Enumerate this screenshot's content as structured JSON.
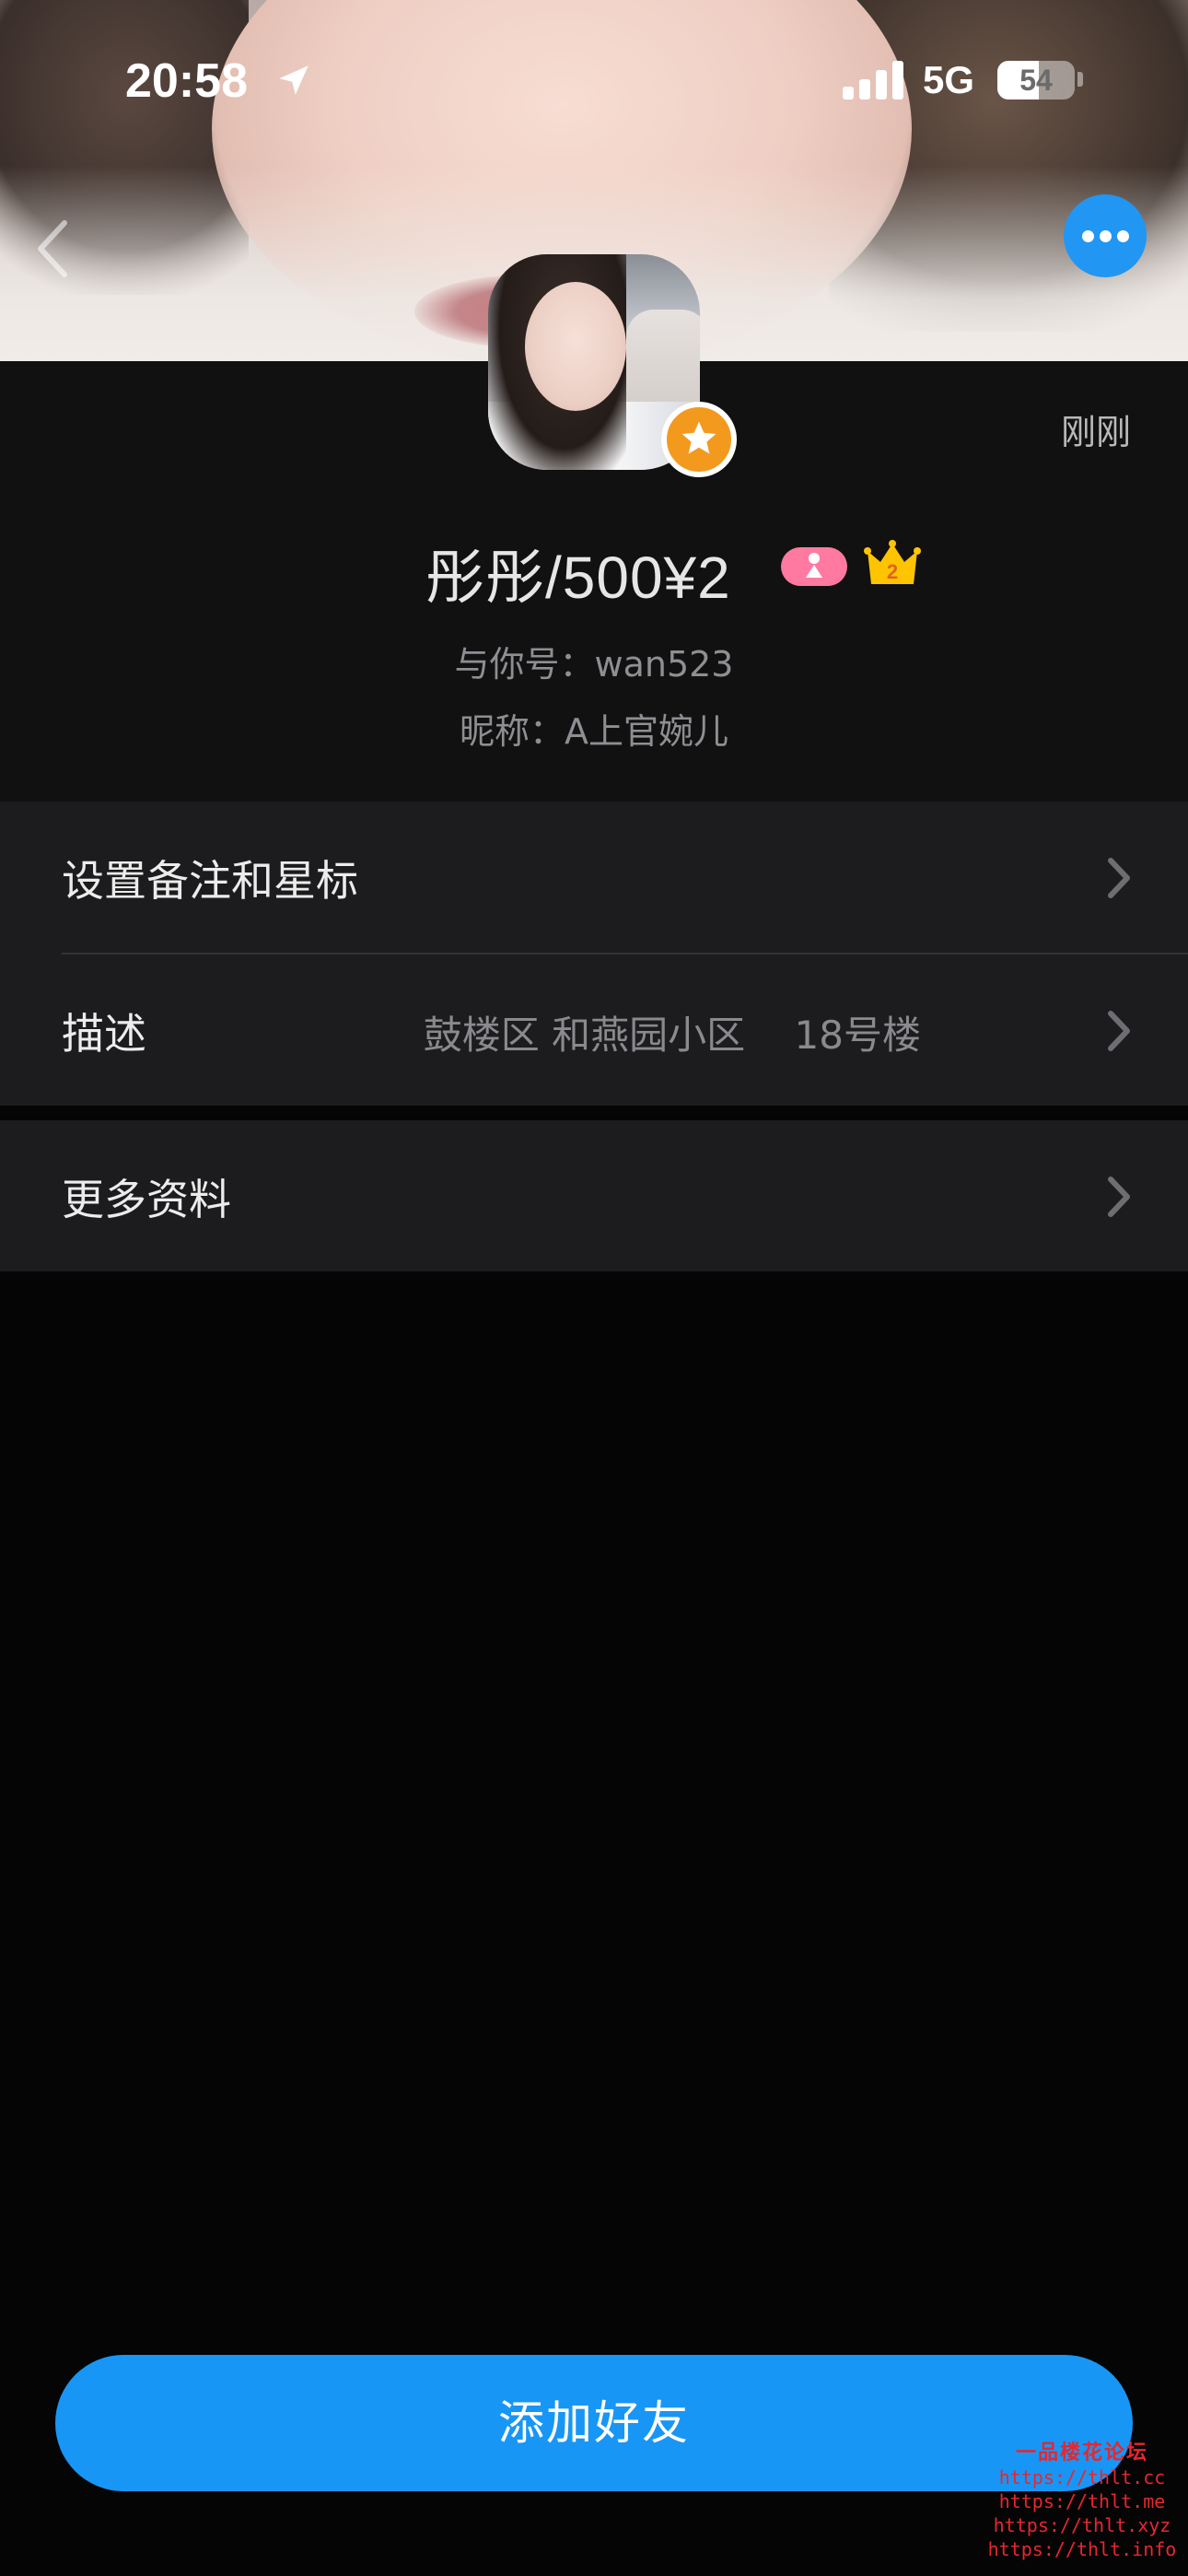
{
  "status_bar": {
    "time": "20:58",
    "network": "5G",
    "battery": "54",
    "battery_level": 0.54
  },
  "header": {
    "last_active": "刚刚",
    "name": "彤彤/500¥2",
    "crown_level": "2",
    "account_line": "与你号：wan523",
    "nickname_line": "昵称：A上官婉儿"
  },
  "list": {
    "remark_label": "设置备注和星标",
    "description_label": "描述",
    "description_value": "鼓楼区 和燕园小区    18号楼",
    "more_label": "更多资料"
  },
  "footer": {
    "add_friend": "添加好友"
  },
  "watermark": {
    "title": "一品楼花论坛",
    "links": [
      "https://thlt.cc",
      "https://thlt.me",
      "https://thlt.xyz",
      "https://thlt.info"
    ]
  },
  "colors": {
    "accent": "#1896f6",
    "more_button": "#2196f3",
    "star_badge": "#f39a1e",
    "gender_badge": "#ff79a1",
    "crown": "#ffc400",
    "background": "#050505",
    "cell": "#1c1c1e"
  },
  "icons": {
    "status": [
      "location-arrow-icon",
      "signal-icon",
      "battery-icon"
    ],
    "nav": [
      "back-chevron-icon",
      "more-dots-icon"
    ],
    "badges": [
      "star-icon",
      "gender-icon",
      "crown-icon"
    ],
    "rows": "chevron-right-icon"
  }
}
